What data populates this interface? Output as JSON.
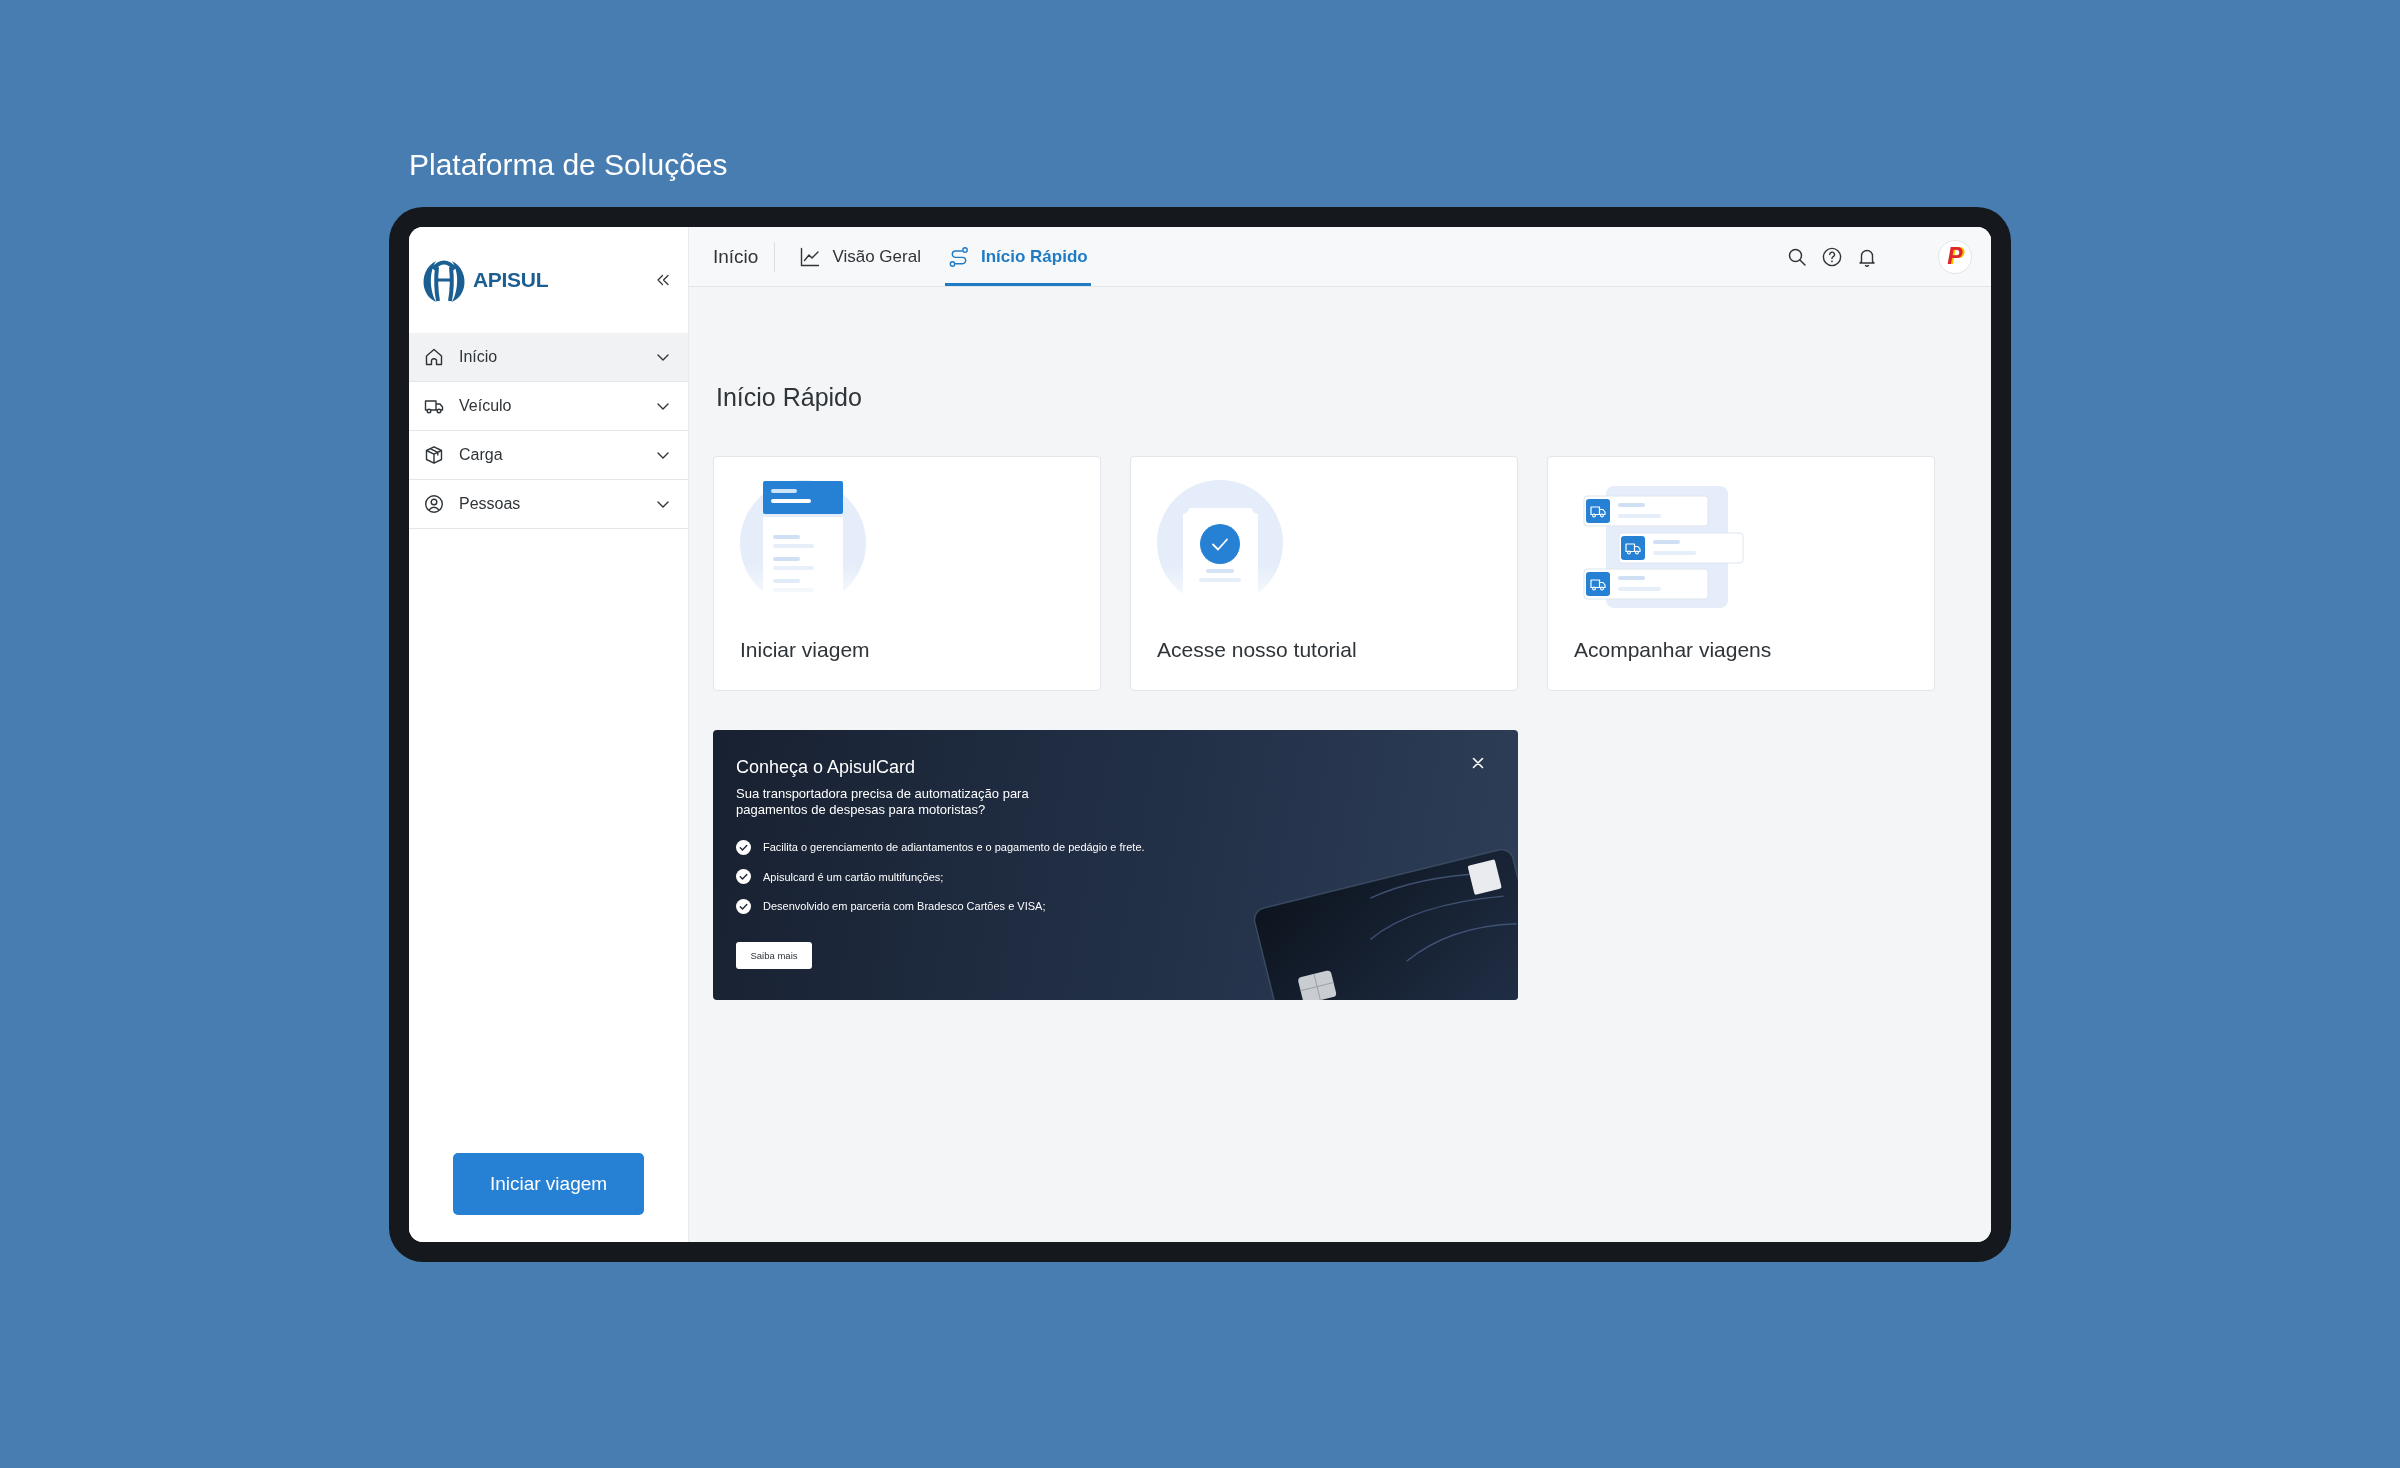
{
  "page": {
    "title": "Plataforma de Soluções"
  },
  "sidebar": {
    "logo_text": "APISUL",
    "items": [
      {
        "label": "Início",
        "selected": true
      },
      {
        "label": "Veículo",
        "selected": false
      },
      {
        "label": "Carga",
        "selected": false
      },
      {
        "label": "Pessoas",
        "selected": false
      }
    ],
    "primary_button": "Iniciar viagem"
  },
  "header": {
    "section": "Início",
    "tabs": [
      {
        "label": "Visão Geral",
        "selected": false
      },
      {
        "label": "Início Rápido",
        "selected": true
      }
    ],
    "avatar_letter": "P"
  },
  "content": {
    "heading": "Início Rápido",
    "cards": [
      {
        "label": "Iniciar viagem"
      },
      {
        "label": "Acesse nosso tutorial"
      },
      {
        "label": "Acompanhar viagens"
      }
    ]
  },
  "banner": {
    "title": "Conheça o ApisulCard",
    "subtitle": "Sua transportadora precisa de automatização para pagamentos de despesas para motoristas?",
    "bullets": [
      "Facilita o gerenciamento de adiantamentos e o pagamento de pedágio e frete.",
      "Apisulcard é um cartão multifunções;",
      "Desenvolvido em parceria com Bradesco Cartões e VISA;"
    ],
    "button": "Saiba mais"
  }
}
